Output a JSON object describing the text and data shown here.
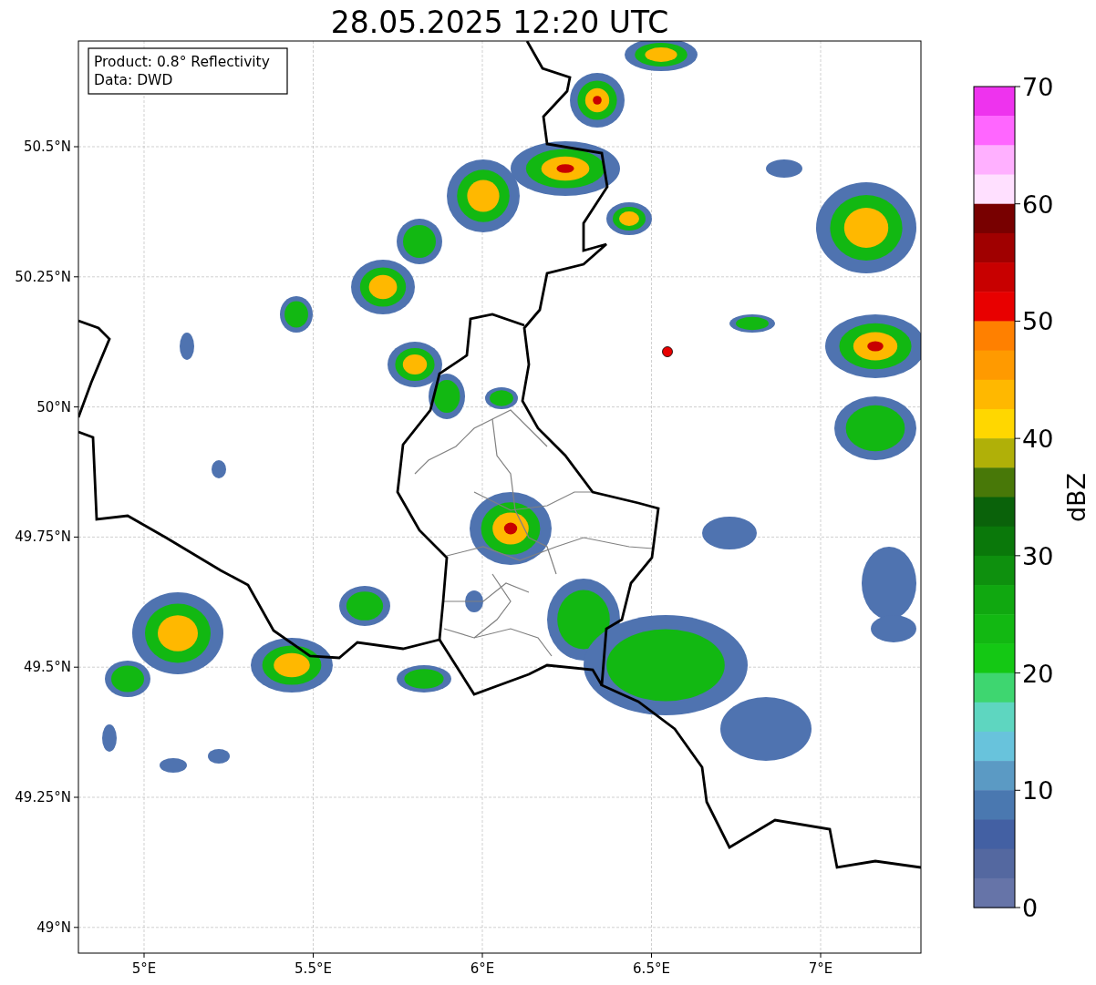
{
  "title": "28.05.2025 12:20 UTC",
  "info": [
    "Product: 0.8° Reflectivity",
    "Data: DWD"
  ],
  "map": {
    "y_ticks": [
      "50.5°N",
      "50.25°N",
      "50°N",
      "49.75°N",
      "49.5°N",
      "49.25°N",
      "49°N"
    ],
    "x_ticks": [
      "5°E",
      "5.5°E",
      "6°E",
      "6.5°E",
      "7°E"
    ]
  },
  "colorbar": {
    "ticks": [
      "70",
      "60",
      "50",
      "40",
      "30",
      "20",
      "10",
      "0"
    ],
    "bins": [
      {
        "color": "#ee33ee"
      },
      {
        "color": "#ff66ff"
      },
      {
        "color": "#ffb0ff"
      },
      {
        "color": "#ffe0ff"
      },
      {
        "color": "#780000"
      },
      {
        "color": "#a00000"
      },
      {
        "color": "#c80000"
      },
      {
        "color": "#e80000"
      },
      {
        "color": "#ff8000"
      },
      {
        "color": "#ff9a00"
      },
      {
        "color": "#ffb800"
      },
      {
        "color": "#ffd700"
      },
      {
        "color": "#b0b008"
      },
      {
        "color": "#487808"
      },
      {
        "color": "#0a620a"
      },
      {
        "color": "#0a780a"
      },
      {
        "color": "#0e900e"
      },
      {
        "color": "#10a810"
      },
      {
        "color": "#12b812"
      },
      {
        "color": "#14c814"
      },
      {
        "color": "#3ed670"
      },
      {
        "color": "#5ed6c0"
      },
      {
        "color": "#68c3dc"
      },
      {
        "color": "#5b9ac4"
      },
      {
        "color": "#4a78b0"
      },
      {
        "color": "#4360a3"
      },
      {
        "color": "#5468a0"
      },
      {
        "color": "#6674a8"
      }
    ],
    "label": "dBZ"
  }
}
